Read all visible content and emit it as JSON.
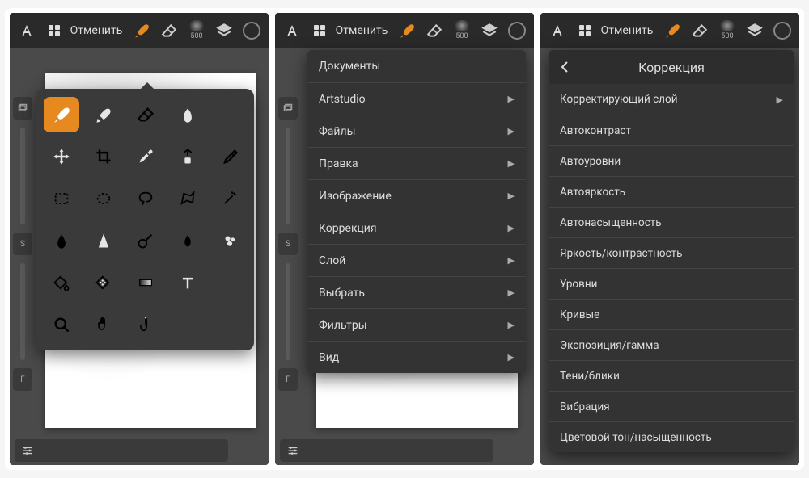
{
  "topbar": {
    "undo_label": "Отменить",
    "brush_size": "500"
  },
  "tool_grid": {
    "rows": [
      [
        "brush",
        "wet-brush",
        "eraser",
        "smudge",
        ""
      ],
      [
        "move",
        "crop",
        "eyedropper",
        "clone",
        "heal"
      ],
      [
        "rect-select",
        "ellipse-select",
        "lasso",
        "poly-lasso",
        "magic-wand"
      ],
      [
        "blur",
        "sharpen",
        "dodge",
        "burn",
        "sponge"
      ],
      [
        "bucket",
        "pattern",
        "gradient",
        "text",
        ""
      ],
      [
        "zoom",
        "pan",
        "touch",
        "",
        ""
      ]
    ],
    "active": "brush"
  },
  "main_menu": {
    "items": [
      {
        "label": "Документы",
        "submenu": false
      },
      {
        "label": "Artstudio",
        "submenu": true
      },
      {
        "label": "Файлы",
        "submenu": true
      },
      {
        "label": "Правка",
        "submenu": true
      },
      {
        "label": "Изображение",
        "submenu": true
      },
      {
        "label": "Коррекция",
        "submenu": true
      },
      {
        "label": "Слой",
        "submenu": true
      },
      {
        "label": "Выбрать",
        "submenu": true
      },
      {
        "label": "Фильтры",
        "submenu": true
      },
      {
        "label": "Вид",
        "submenu": true
      }
    ]
  },
  "correction_menu": {
    "title": "Коррекция",
    "items": [
      {
        "label": "Корректирующий слой",
        "submenu": true
      },
      {
        "label": "Автоконтраст",
        "submenu": false
      },
      {
        "label": "Автоуровни",
        "submenu": false
      },
      {
        "label": "Автояркость",
        "submenu": false
      },
      {
        "label": "Автонасыщенность",
        "submenu": false
      },
      {
        "label": "Яркость/контрастность",
        "submenu": false
      },
      {
        "label": "Уровни",
        "submenu": false
      },
      {
        "label": "Кривые",
        "submenu": false
      },
      {
        "label": "Экспозиция/гамма",
        "submenu": false
      },
      {
        "label": "Тени/блики",
        "submenu": false
      },
      {
        "label": "Вибрация",
        "submenu": false
      },
      {
        "label": "Цветовой тон/насыщенность",
        "submenu": false
      }
    ]
  },
  "rail": {
    "s_label": "S",
    "f_label": "F"
  }
}
